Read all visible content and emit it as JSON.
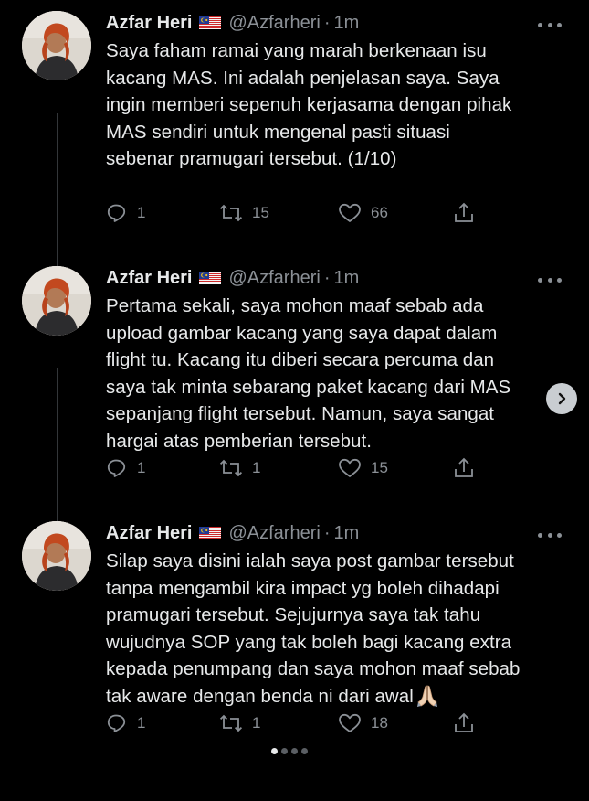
{
  "author": {
    "display_name": "Azfar Heri",
    "handle": "@Azfarheri",
    "time": "1m",
    "flag_icon": "malaysia-flag-icon"
  },
  "tweets": [
    {
      "text": "Saya faham ramai yang marah berkenaan isu kacang MAS. Ini adalah penjelasan saya. Saya ingin memberi sepenuh kerjasama dengan pihak MAS sendiri untuk mengenal pasti situasi sebenar pramugari tersebut. (1/10)",
      "lines": [
        "Saya faham ramai yang marah berkenaan isu",
        "kacang MAS. Ini adalah penjelasan saya. Saya",
        "ingin memberi sepenuh kerjasama dengan pihak",
        "MAS sendiri untuk mengenal pasti situasi",
        "sebenar pramugari tersebut. (1/10)"
      ],
      "replies": "1",
      "retweets": "15",
      "likes": "66"
    },
    {
      "text": "Pertama sekali, saya mohon maaf sebab ada upload gambar kacang yang saya dapat dalam flight tu. Kacang itu diberi secara percuma dan saya tak minta sebarang paket kacang dari MAS sepanjang flight tersebut. Namun, saya sangat hargai atas pemberian tersebut.",
      "lines": [
        "Pertama sekali, saya mohon maaf sebab ada",
        "upload gambar kacang yang saya dapat dalam",
        "flight tu. Kacang itu diberi secara percuma dan",
        "saya tak minta sebarang paket kacang dari MAS",
        "sepanjang flight tersebut. Namun, saya sangat",
        "hargai atas pemberian tersebut."
      ],
      "replies": "1",
      "retweets": "1",
      "likes": "15"
    },
    {
      "text": "Silap saya disini ialah saya post gambar tersebut tanpa mengambil kira impact yg boleh dihadapi pramugari tersebut. Sejujurnya saya tak tahu wujudnya SOP yang tak boleh bagi kacang extra kepada penumpang dan saya mohon maaf sebab tak aware dengan benda ni dari awal🙏🏻",
      "lines": [
        "Silap saya disini ialah saya post gambar tersebut",
        "tanpa mengambil kira impact yg boleh dihadapi",
        "pramugari tersebut. Sejujurnya saya tak tahu",
        "wujudnya SOP yang tak boleh bagi kacang extra",
        "kepada penumpang dan saya mohon maaf sebab",
        "tak aware dengan benda ni dari awal"
      ],
      "replies": "1",
      "retweets": "1",
      "likes": "18"
    }
  ],
  "carousel": {
    "page_count": 4,
    "active_index": 0
  },
  "colors": {
    "background": "#000000",
    "primary_text": "#e7e9ea",
    "secondary_text": "#8b9096",
    "thread_line": "#333639"
  }
}
